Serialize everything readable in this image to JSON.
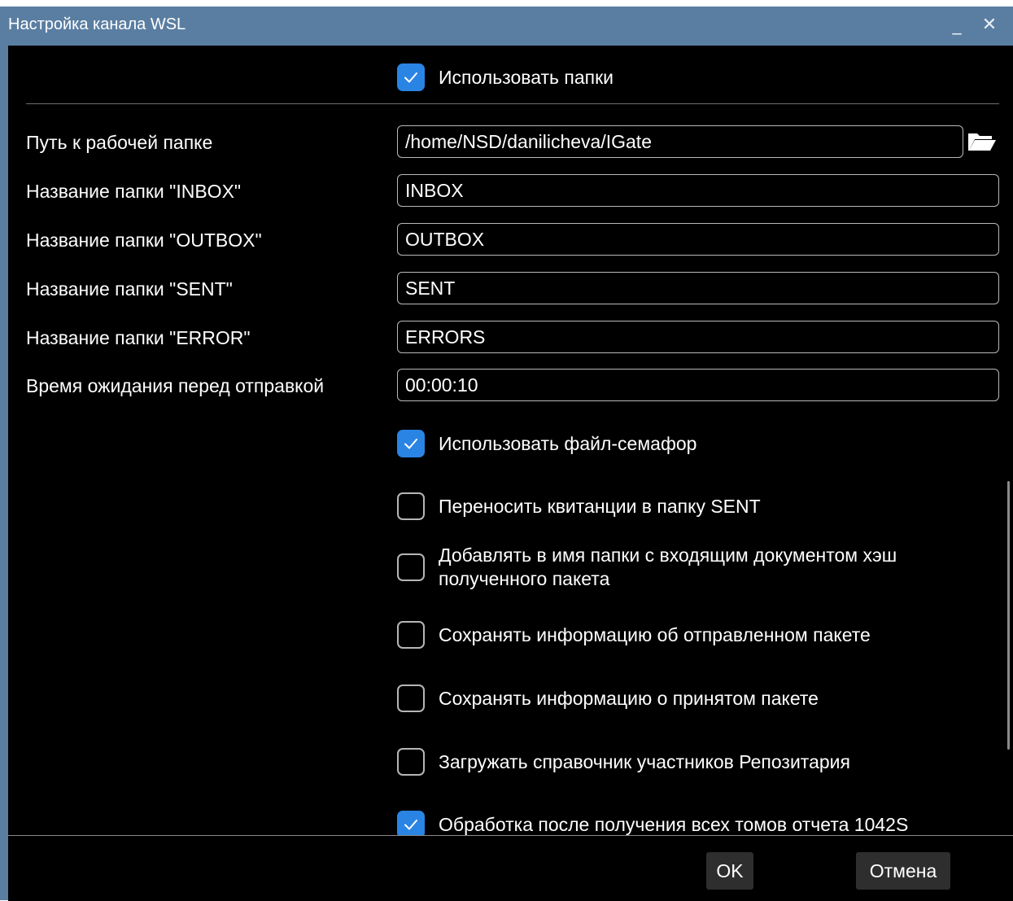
{
  "window": {
    "title": "Настройка канала WSL",
    "minimize_glyph": "_",
    "close_glyph": "✕"
  },
  "use_folders": {
    "label": "Использовать папки",
    "checked": true
  },
  "fields": {
    "work_path": {
      "label": "Путь к рабочей папке",
      "value": "/home/NSD/danilicheva/IGate"
    },
    "inbox": {
      "label": "Название папки \"INBOX\"",
      "value": "INBOX"
    },
    "outbox": {
      "label": "Название папки \"OUTBOX\"",
      "value": "OUTBOX"
    },
    "sent": {
      "label": "Название папки \"SENT\"",
      "value": "SENT"
    },
    "error": {
      "label": "Название папки \"ERROR\"",
      "value": "ERRORS"
    },
    "wait_time": {
      "label": "Время ожидания перед отправкой",
      "value": "00:00:10"
    }
  },
  "options": [
    {
      "label": "Использовать файл-семафор",
      "checked": true
    },
    {
      "label": "Переносить квитанции в папку SENT",
      "checked": false
    },
    {
      "label_line1": "Добавлять в имя папки с входящим документом хэш",
      "label_line2": "полученного пакета",
      "checked": false
    },
    {
      "label": "Сохранять информацию об отправленном пакете",
      "checked": false
    },
    {
      "label": "Сохранять информацию о принятом пакете",
      "checked": false
    },
    {
      "label": "Загружать справочник участников Репозитария",
      "checked": false
    },
    {
      "label": "Обработка после получения всех томов отчета 1042S",
      "checked": true
    }
  ],
  "buttons": {
    "ok": "OK",
    "cancel": "Отмена"
  },
  "icons": {
    "check": "checkmark-icon",
    "folder": "folder-open-icon"
  },
  "colors": {
    "titlebar": "#5a7ea2",
    "accent": "#2a84e4",
    "background": "#000000"
  }
}
